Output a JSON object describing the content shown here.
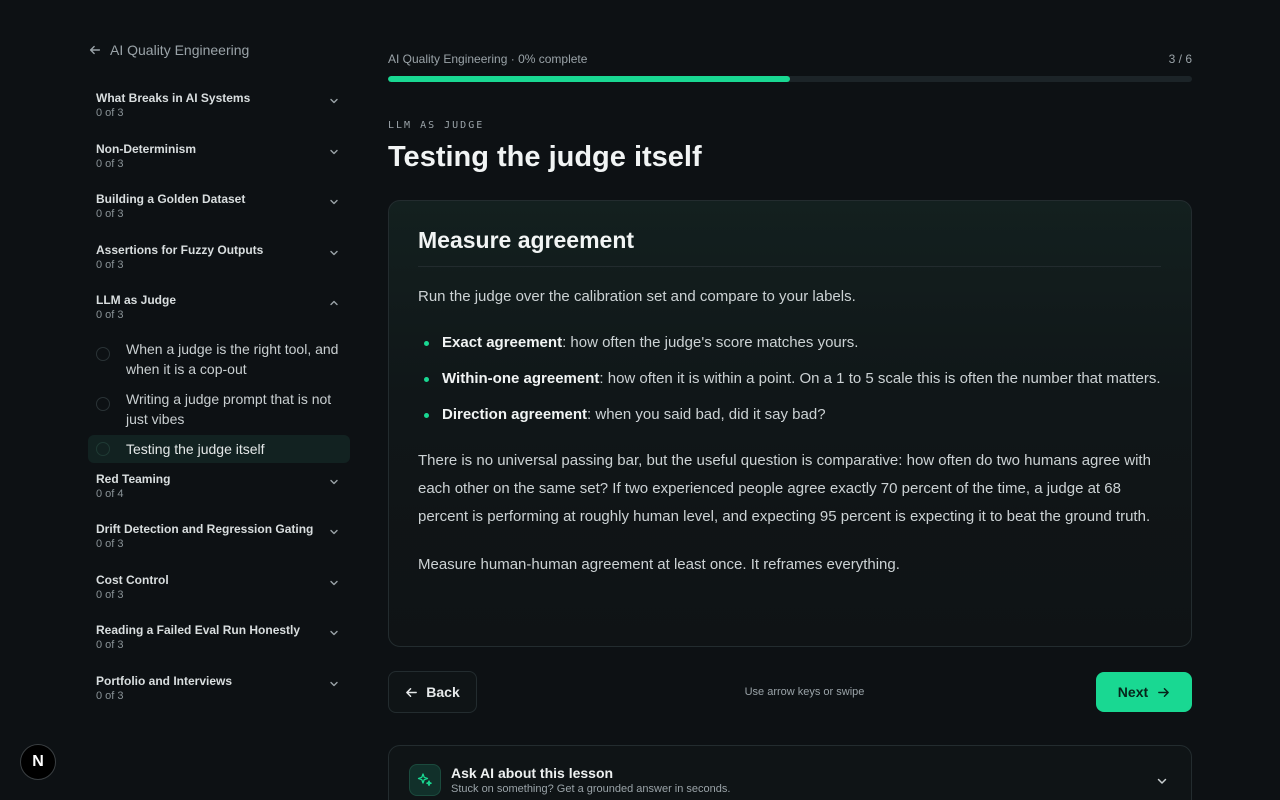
{
  "sidebar": {
    "back_label": "AI Quality Engineering",
    "modules_before": [
      {
        "title": "What Breaks in AI Systems",
        "count": "0 of 3"
      },
      {
        "title": "Non-Determinism",
        "count": "0 of 3"
      },
      {
        "title": "Building a Golden Dataset",
        "count": "0 of 3"
      },
      {
        "title": "Assertions for Fuzzy Outputs",
        "count": "0 of 3"
      }
    ],
    "open_module": {
      "title": "LLM as Judge",
      "count": "0 of 3"
    },
    "lessons": [
      {
        "label": "When a judge is the right tool, and when it is a cop-out"
      },
      {
        "label": "Writing a judge prompt that is not just vibes"
      },
      {
        "label": "Testing the judge itself"
      }
    ],
    "modules_after": [
      {
        "title": "Red Teaming",
        "count": "0 of 4"
      },
      {
        "title": "Drift Detection and Regression Gating",
        "count": "0 of 3"
      },
      {
        "title": "Cost Control",
        "count": "0 of 3"
      },
      {
        "title": "Reading a Failed Eval Run Honestly",
        "count": "0 of 3"
      },
      {
        "title": "Portfolio and Interviews",
        "count": "0 of 3"
      }
    ]
  },
  "progress": {
    "label": "AI Quality Engineering · 0% complete",
    "step": "3 / 6",
    "fraction": 0.5
  },
  "lesson": {
    "eyebrow": "LLM AS JUDGE",
    "title": "Testing the judge itself",
    "heading": "Measure agreement",
    "intro": "Run the judge over the calibration set and compare to your labels.",
    "bullets": [
      {
        "term": "Exact agreement",
        "text": ": how often the judge's score matches yours."
      },
      {
        "term": "Within-one agreement",
        "text": ": how often it is within a point. On a 1 to 5 scale this is often the number that matters."
      },
      {
        "term": "Direction agreement",
        "text": ": when you said bad, did it say bad?"
      }
    ],
    "para2": "There is no universal passing bar, but the useful question is comparative: how often do two humans agree with each other on the same set? If two experienced people agree exactly 70 percent of the time, a judge at 68 percent is performing at roughly human level, and expecting 95 percent is expecting it to beat the ground truth.",
    "para3": "Measure human-human agreement at least once. It reframes everything."
  },
  "nav": {
    "back_label": "Back",
    "hint": "Use arrow keys or swipe",
    "next_label": "Next"
  },
  "ask_ai": {
    "title": "Ask AI about this lesson",
    "subtitle": "Stuck on something? Get a grounded answer in seconds."
  },
  "badge": {
    "letter": "N"
  },
  "colors": {
    "accent": "#19d892",
    "background": "#0d1114"
  }
}
